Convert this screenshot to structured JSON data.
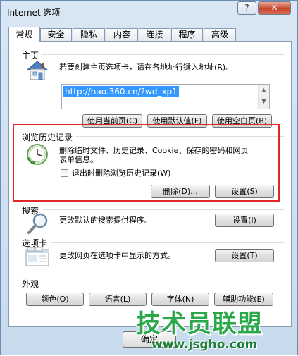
{
  "window": {
    "title": "Internet 选项",
    "help_label": "?",
    "close_label": "✕"
  },
  "tabs": [
    {
      "label": "常规",
      "active": true
    },
    {
      "label": "安全"
    },
    {
      "label": "隐私"
    },
    {
      "label": "内容"
    },
    {
      "label": "连接"
    },
    {
      "label": "程序"
    },
    {
      "label": "高级"
    }
  ],
  "homepage": {
    "group_label": "主页",
    "description": "若要创建主页选项卡，请在各地址行键入地址(R)。",
    "url_value": "http://hao.360.cn/?wd_xp1",
    "buttons": {
      "use_current": "使用当前页(C)",
      "use_default": "使用默认值(F)",
      "use_blank": "使用空白页(B)"
    }
  },
  "history": {
    "group_label": "浏览历史记录",
    "description_line1": "删除临时文件、历史记录、Cookie、保存的密码和网页",
    "description_line2": "表单信息。",
    "checkbox_label": "退出时删除浏览历史记录(W)",
    "checkbox_checked": false,
    "delete_button": "删除(D)...",
    "settings_button": "设置(S)"
  },
  "search": {
    "group_label": "搜索",
    "description": "更改默认的搜索提供程序。",
    "settings_button": "设置(I)"
  },
  "tabs_section": {
    "group_label": "选项卡",
    "description": "更改网页在选项卡中显示的方式。",
    "settings_button": "设置(T)"
  },
  "appearance": {
    "group_label": "外观",
    "buttons": {
      "colors": "颜色(O)",
      "languages": "语言(L)",
      "fonts": "字体(N)",
      "accessibility": "辅助功能(E)"
    }
  },
  "footer": {
    "ok_button": "确定"
  },
  "watermark": {
    "main_text": "技术员联盟",
    "url_text": "www.jsgho.com"
  },
  "colors": {
    "highlight_border": "#e02626",
    "selection": "#3399ff",
    "watermark_green": "#2aa84a"
  }
}
